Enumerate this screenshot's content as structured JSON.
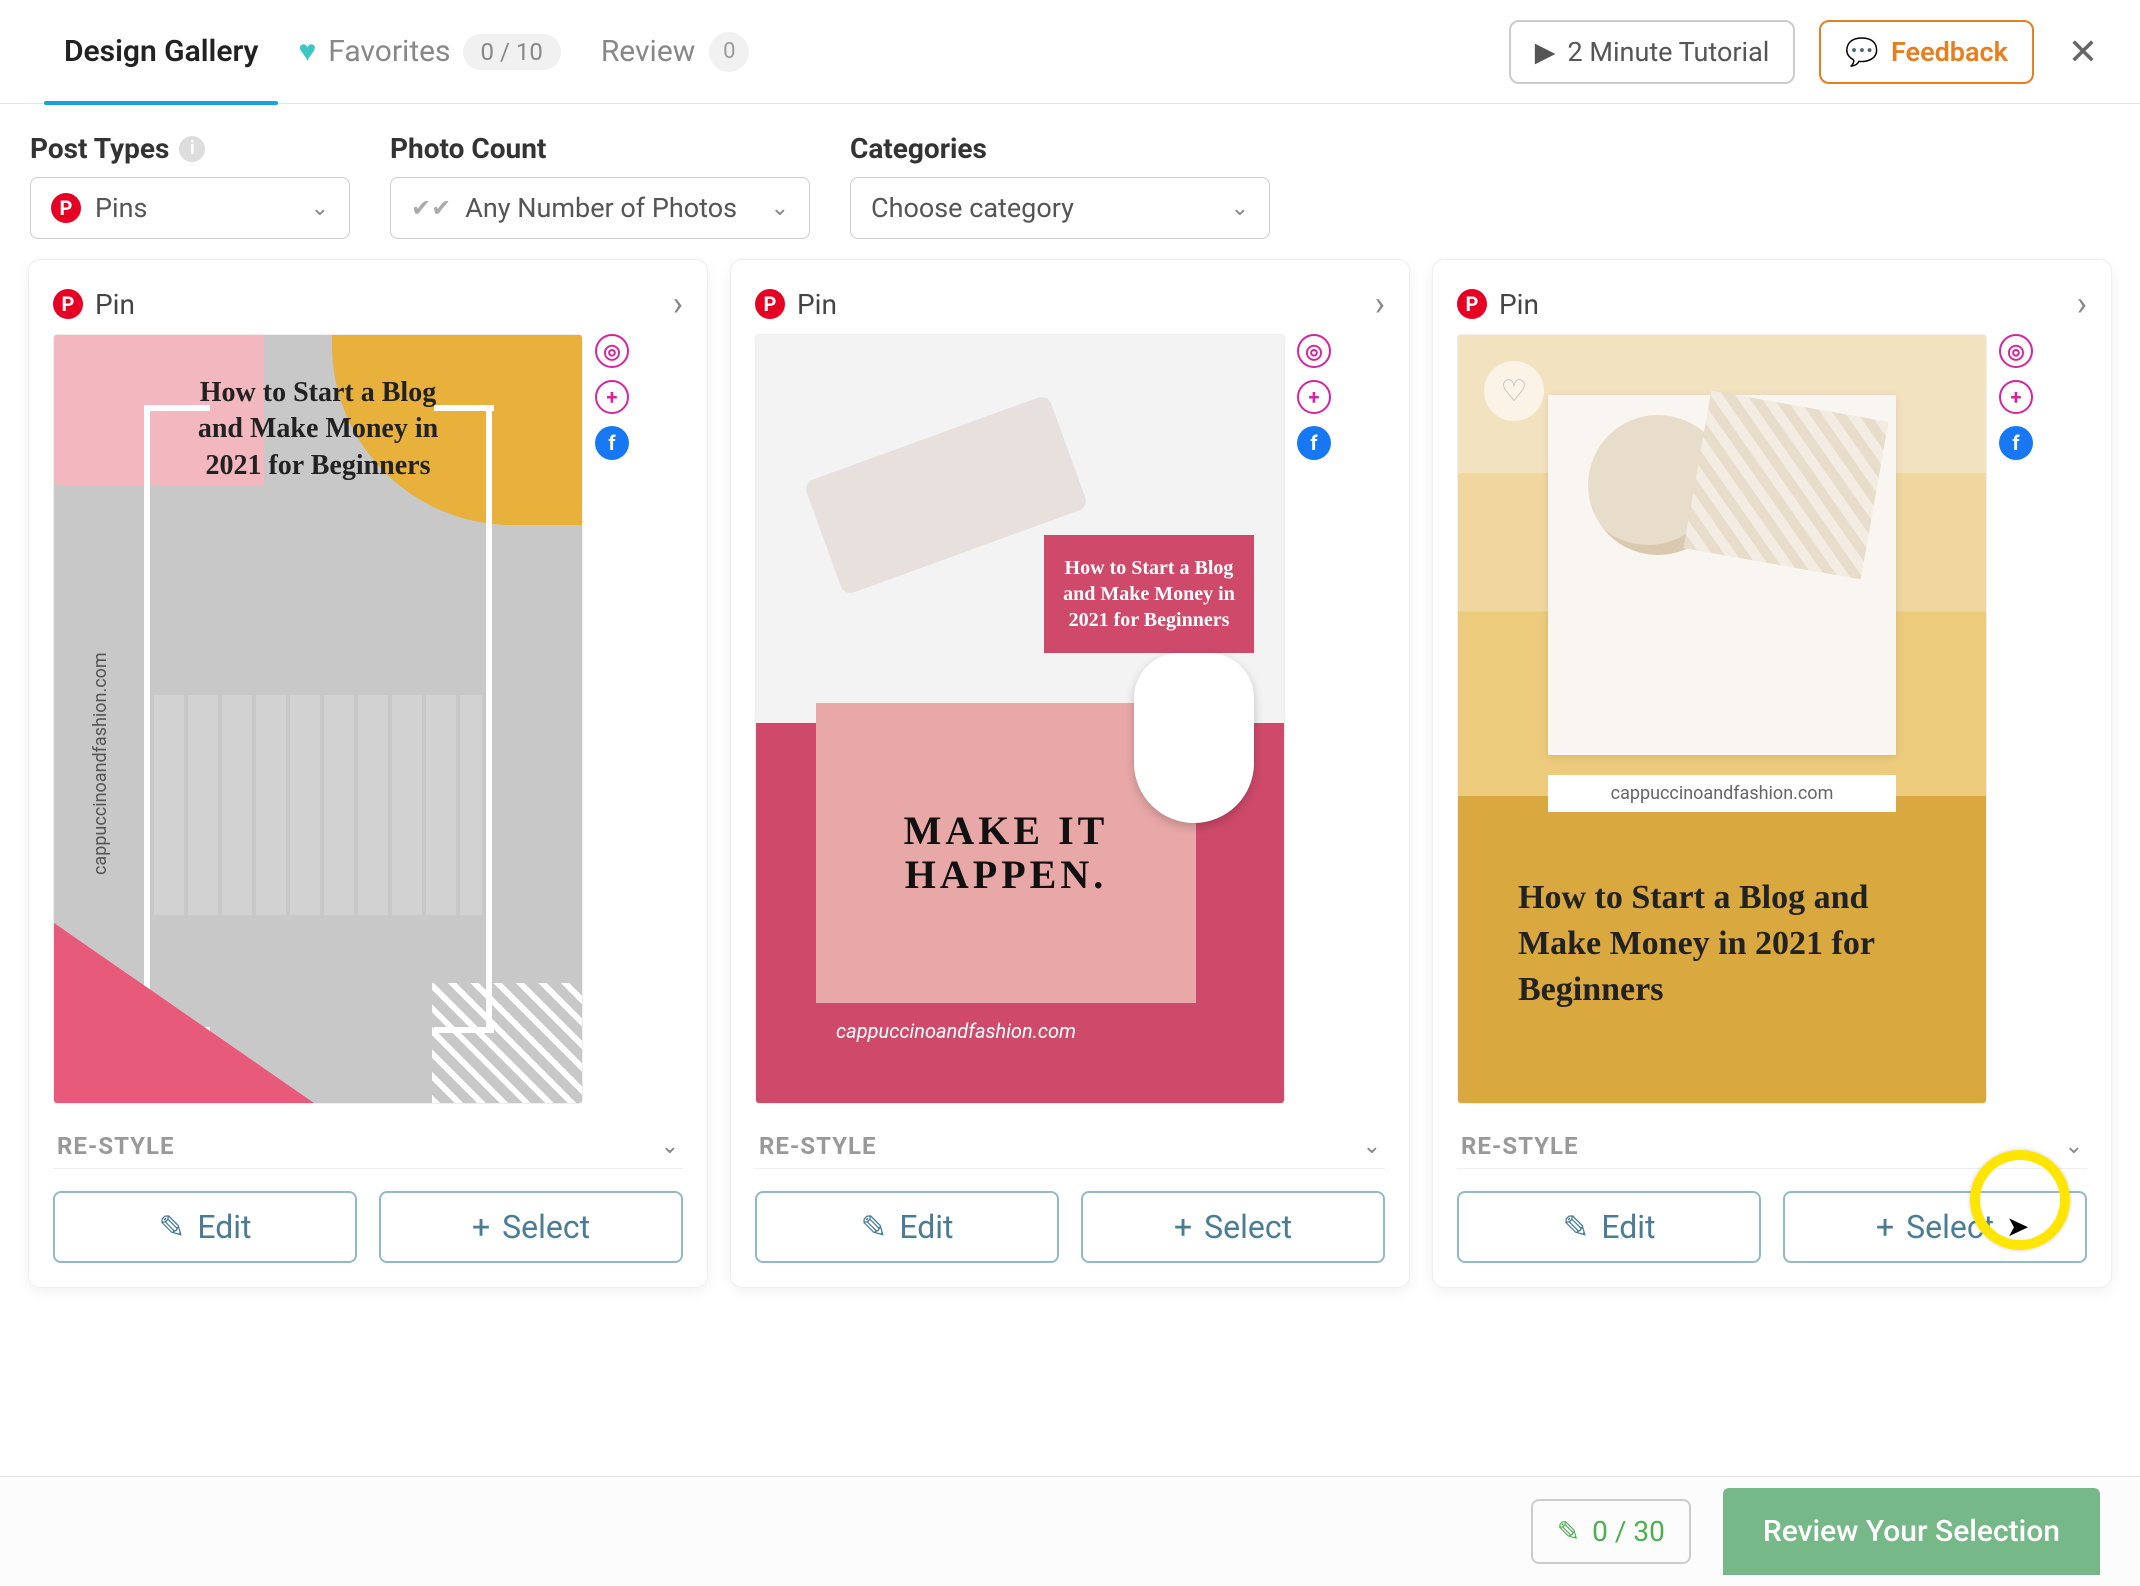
{
  "tabs": {
    "design_gallery": "Design Gallery",
    "favorites": "Favorites",
    "favorites_count": "0 / 10",
    "review": "Review",
    "review_count": "0"
  },
  "top_buttons": {
    "tutorial": "2 Minute Tutorial",
    "feedback": "Feedback"
  },
  "filters": {
    "post_types": {
      "label": "Post Types",
      "value": "Pins"
    },
    "photo_count": {
      "label": "Photo Count",
      "value": "Any Number of Photos"
    },
    "categories": {
      "label": "Categories",
      "value": "Choose category"
    }
  },
  "cards": [
    {
      "pin_label": "Pin",
      "restyle": "RE-STYLE",
      "edit": "Edit",
      "select": "Select",
      "preview": {
        "title": "How to Start a Blog and Make Money in 2021 for Beginners",
        "side_url": "cappuccinoandfashion.com"
      }
    },
    {
      "pin_label": "Pin",
      "restyle": "RE-STYLE",
      "edit": "Edit",
      "select": "Select",
      "preview": {
        "badge": "How to Start a Blog and Make Money in 2021 for Beginners",
        "card_text": "MAKE IT HAPPEN.",
        "url": "cappuccinoandfashion.com"
      }
    },
    {
      "pin_label": "Pin",
      "restyle": "RE-STYLE",
      "edit": "Edit",
      "select": "Select",
      "preview": {
        "title": "How to Start a Blog and Make Money in 2021 for Beginners",
        "url": "cappuccinoandfashion.com"
      }
    }
  ],
  "bottom": {
    "counter": "0 / 30",
    "review_button": "Review Your Selection"
  }
}
